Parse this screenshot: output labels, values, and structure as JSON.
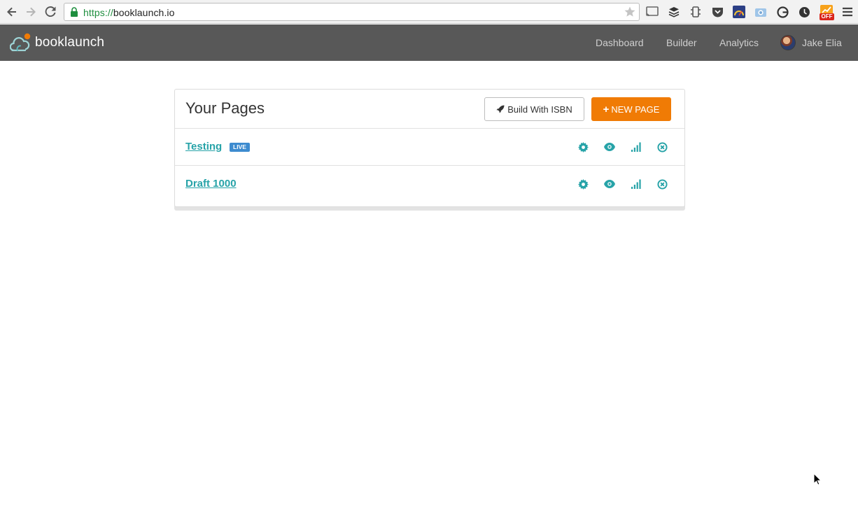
{
  "browser": {
    "url_scheme": "https://",
    "url_host": "booklaunch.io"
  },
  "app": {
    "brand": "booklaunch",
    "nav": [
      "Dashboard",
      "Builder",
      "Analytics"
    ],
    "user_name": "Jake Elia",
    "ext_badge": "OFF"
  },
  "panel": {
    "title": "Your Pages",
    "isbn_label": "Build With ISBN",
    "new_label": "NEW PAGE",
    "pages": [
      {
        "name": "Testing",
        "badge": "LIVE"
      },
      {
        "name": "Draft 1000",
        "badge": ""
      }
    ]
  },
  "colors": {
    "accent": "#27a3a8",
    "orange": "#f07b05",
    "header": "#585858",
    "badge": "#3d8bcf"
  }
}
